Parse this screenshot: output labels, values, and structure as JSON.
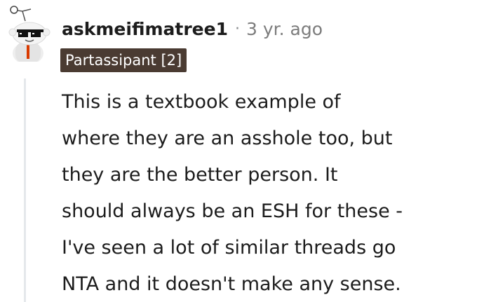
{
  "comment": {
    "username": "askmeifimatree1",
    "separator": "·",
    "timestamp": "3 yr. ago",
    "flair": "Partassipant [2]",
    "body_lines": [
      "This is a textbook example of",
      "where they are an asshole too, but",
      "they are the better person. It",
      "should always be an ESH for these -",
      "I've seen a lot of similar threads go",
      "NTA and it doesn't make any sense."
    ]
  },
  "colors": {
    "flair_background": "#4a3b32",
    "flair_text": "#ffffff",
    "timestamp": "#7c7c7c",
    "thread_line": "#e5e8eb"
  },
  "icons": {
    "avatar": "snoo-avatar-with-sunglasses"
  }
}
